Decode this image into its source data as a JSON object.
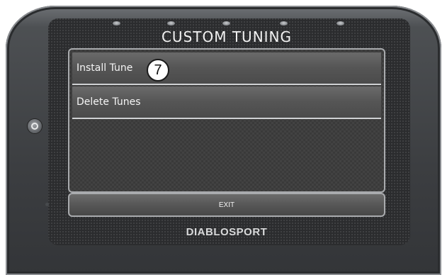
{
  "header": {
    "title": "CUSTOM TUNING"
  },
  "menu": {
    "items": [
      {
        "label": "Install Tune"
      },
      {
        "label": "Delete Tunes"
      }
    ]
  },
  "callout": {
    "number": "7"
  },
  "footer": {
    "exit_label": "EXIT"
  },
  "brand": {
    "name": "DIABLOSPORT"
  },
  "icons": {
    "power": "power-button-icon",
    "leds": "indicator-led-icon"
  },
  "colors": {
    "screen_bg": "#3a3a3a",
    "menu_item": "#555555",
    "separator": "#cfd1d3",
    "text": "#f5f5f5",
    "device_shell": "#3c3e41"
  }
}
